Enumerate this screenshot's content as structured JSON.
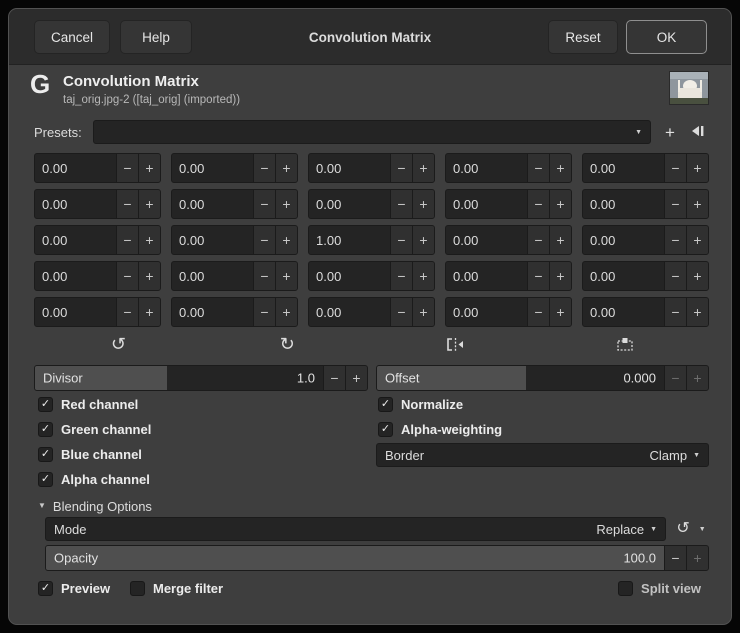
{
  "colors": {
    "window_bg": "#3e3e3e",
    "titlebar_bg": "#2c2c2c",
    "entry_bg": "#242424",
    "slider_fill": "#4f4f4f",
    "text": "#e0e0e0"
  },
  "icons": {
    "minus": "−",
    "plus": "+",
    "dropdown": "▼",
    "check": "✓",
    "rotate_ccw": "↺",
    "rotate_cw": "↻",
    "expander": "▼",
    "reset": "↺"
  },
  "titlebar": {
    "cancel": "Cancel",
    "help": "Help",
    "title": "Convolution Matrix",
    "reset": "Reset",
    "ok": "OK"
  },
  "header": {
    "title": "Convolution Matrix",
    "subtitle": "taj_orig.jpg-2 ([taj_orig] (imported))",
    "logo_glyph": "G"
  },
  "presets": {
    "label": "Presets:",
    "value": ""
  },
  "matrix": {
    "values": [
      [
        "0.00",
        "0.00",
        "0.00",
        "0.00",
        "0.00"
      ],
      [
        "0.00",
        "0.00",
        "0.00",
        "0.00",
        "0.00"
      ],
      [
        "0.00",
        "0.00",
        "1.00",
        "0.00",
        "0.00"
      ],
      [
        "0.00",
        "0.00",
        "0.00",
        "0.00",
        "0.00"
      ],
      [
        "0.00",
        "0.00",
        "0.00",
        "0.00",
        "0.00"
      ]
    ]
  },
  "sliders": {
    "divisor": {
      "label": "Divisor",
      "value": "1.0",
      "fill_pct": 46
    },
    "offset": {
      "label": "Offset",
      "value": "0.000",
      "fill_pct": 52
    },
    "opacity": {
      "label": "Opacity",
      "value": "100.0",
      "fill_pct": 100
    }
  },
  "checkboxes": {
    "red": {
      "label": "Red channel",
      "checked": true
    },
    "green": {
      "label": "Green channel",
      "checked": true
    },
    "blue": {
      "label": "Blue channel",
      "checked": true
    },
    "alpha": {
      "label": "Alpha channel",
      "checked": true
    },
    "normalize": {
      "label": "Normalize",
      "checked": true
    },
    "alpha_weighting": {
      "label": "Alpha-weighting",
      "checked": true
    },
    "preview": {
      "label": "Preview",
      "checked": true
    },
    "merge_filter": {
      "label": "Merge filter",
      "checked": false
    },
    "split_view": {
      "label": "Split view",
      "checked": false
    }
  },
  "border": {
    "label": "Border",
    "value": "Clamp"
  },
  "blending": {
    "section": "Blending Options",
    "mode_label": "Mode",
    "mode_value": "Replace"
  }
}
